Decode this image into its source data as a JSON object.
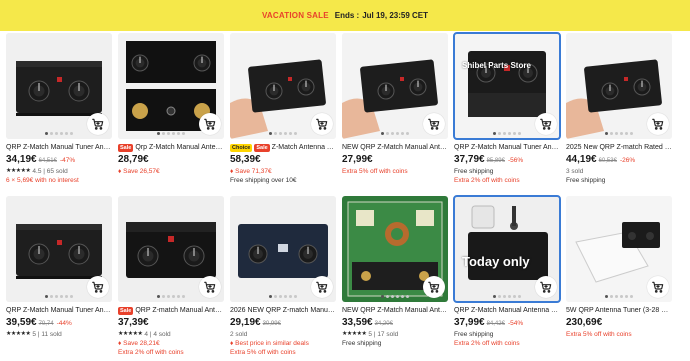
{
  "banner": {
    "tag": "VACATION SALE",
    "ends_label": "Ends :",
    "ends_time": "Jul 19, 23:59 CET"
  },
  "colors": {
    "banner_bg": "#f5e84a",
    "accent_red": "#e8412b",
    "selected_outline": "#3a7bd5"
  },
  "products": [
    {
      "title": "QRP Z-Match Manual Tuner Antenna",
      "badge": "",
      "price": "34,19€",
      "orig": "64,51€",
      "disc": "-47%",
      "line1_stars": "★★★★★",
      "line1": "4.5 | 65 sold",
      "line1_class": "gray",
      "line2": "6 × 5,69€ with no interest",
      "line2_class": "red",
      "image": "box-front",
      "img_text": ""
    },
    {
      "title": "Qrp Z-Match Manual Antenna Tuner",
      "badge": "Sale",
      "price": "28,79€",
      "orig": "",
      "disc": "",
      "line1_stars": "",
      "line1": "♦ Save 26,57€",
      "line1_class": "red",
      "line2": "",
      "line2_class": "red",
      "image": "panels",
      "img_text": ""
    },
    {
      "title": "Z-Match Antenna Tuner",
      "badge2": "Choice",
      "badge": "Sale",
      "price": "58,39€",
      "orig": "",
      "disc": "",
      "line1_stars": "",
      "line1": "♦ Save 71,37€",
      "line1_class": "red",
      "line2": "Free shipping over 10€",
      "line2_class": "dark",
      "image": "hand",
      "img_text": ""
    },
    {
      "title": "NEW QRP Z-Match Manual Antenna",
      "badge": "",
      "price": "27,99€",
      "orig": "",
      "disc": "",
      "line1_stars": "",
      "line1": "Extra 5% off with coins",
      "line1_class": "red",
      "line2": "",
      "line2_class": "red",
      "image": "hand2",
      "img_text": ""
    },
    {
      "title": "QRP Z-Match Manual Tuner Antenna",
      "badge": "",
      "price": "37,79€",
      "orig": "85,89€",
      "disc": "-56%",
      "line1_stars": "",
      "line1": "Free shipping",
      "line1_class": "dark",
      "line2": "Extra 2% off with coins",
      "line2_class": "red",
      "image": "box-top",
      "img_text": "Shibel Parts Store",
      "selected": true
    },
    {
      "title": "2025 New QRP Z-match Rated Power",
      "badge": "",
      "price": "44,19€",
      "orig": "60,53€",
      "disc": "-26%",
      "line1_stars": "",
      "line1": "3 sold",
      "line1_class": "gray",
      "line2": "Free shipping",
      "line2_class": "dark",
      "image": "hand3",
      "img_text": ""
    },
    {
      "title": "QRP Z-Match Manual Tuner Antenna",
      "badge": "",
      "price": "39,59€",
      "orig": "70,74",
      "disc": "-44%",
      "line1_stars": "★★★★★",
      "line1": "5 | 11 sold",
      "line1_class": "gray",
      "line2": "",
      "line2_class": "red",
      "image": "box-front",
      "img_text": ""
    },
    {
      "title": "QRP Z-match Manual Antenna Tuner",
      "badge": "Sale",
      "price": "37,39€",
      "orig": "",
      "disc": "",
      "line1_stars": "★★★★★",
      "line1": "4 | 4 sold",
      "line1_class": "gray",
      "line2": "♦ Save 28,21€",
      "line2_class": "red",
      "line3": "Extra 2% off with coins",
      "image": "box-label",
      "img_text": ""
    },
    {
      "title": "2026 NEW QRP Z-match Manual Antenna",
      "badge": "",
      "price": "29,19€",
      "orig": "30,99€",
      "disc": "",
      "line1_stars": "",
      "line1": "2 sold",
      "line1_class": "gray",
      "line2": "♦ Best price in similar deals",
      "line2_class": "red",
      "line3": "Extra 5% off with coins",
      "image": "box-blue",
      "img_text": ""
    },
    {
      "title": "NEW QRP Z-Match Manual Antenna",
      "badge": "",
      "price": "33,59€",
      "orig": "34,20€",
      "disc": "",
      "line1_stars": "★★★★★",
      "line1": "5 | 17 sold",
      "line1_class": "gray",
      "line2": "Free shipping",
      "line2_class": "dark",
      "image": "pcb",
      "img_text": ""
    },
    {
      "title": "QRP Z-Match Manual Antenna Tuner",
      "badge": "",
      "price": "37,99€",
      "orig": "84,42€",
      "disc": "-54%",
      "line1_stars": "",
      "line1": "Free shipping",
      "line1_class": "dark",
      "line2": "Extra 2% off with coins",
      "line2_class": "red",
      "image": "box-today",
      "img_text": "Today only",
      "selected": true
    },
    {
      "title": "5W QRP Antenna Tuner (3-28 MHz)",
      "badge": "",
      "price": "230,69€",
      "orig": "",
      "disc": "",
      "line1_stars": "",
      "line1": "Extra 5% off with coins",
      "line1_class": "red",
      "line2": "",
      "line2_class": "red",
      "image": "white-box",
      "img_text": ""
    }
  ]
}
